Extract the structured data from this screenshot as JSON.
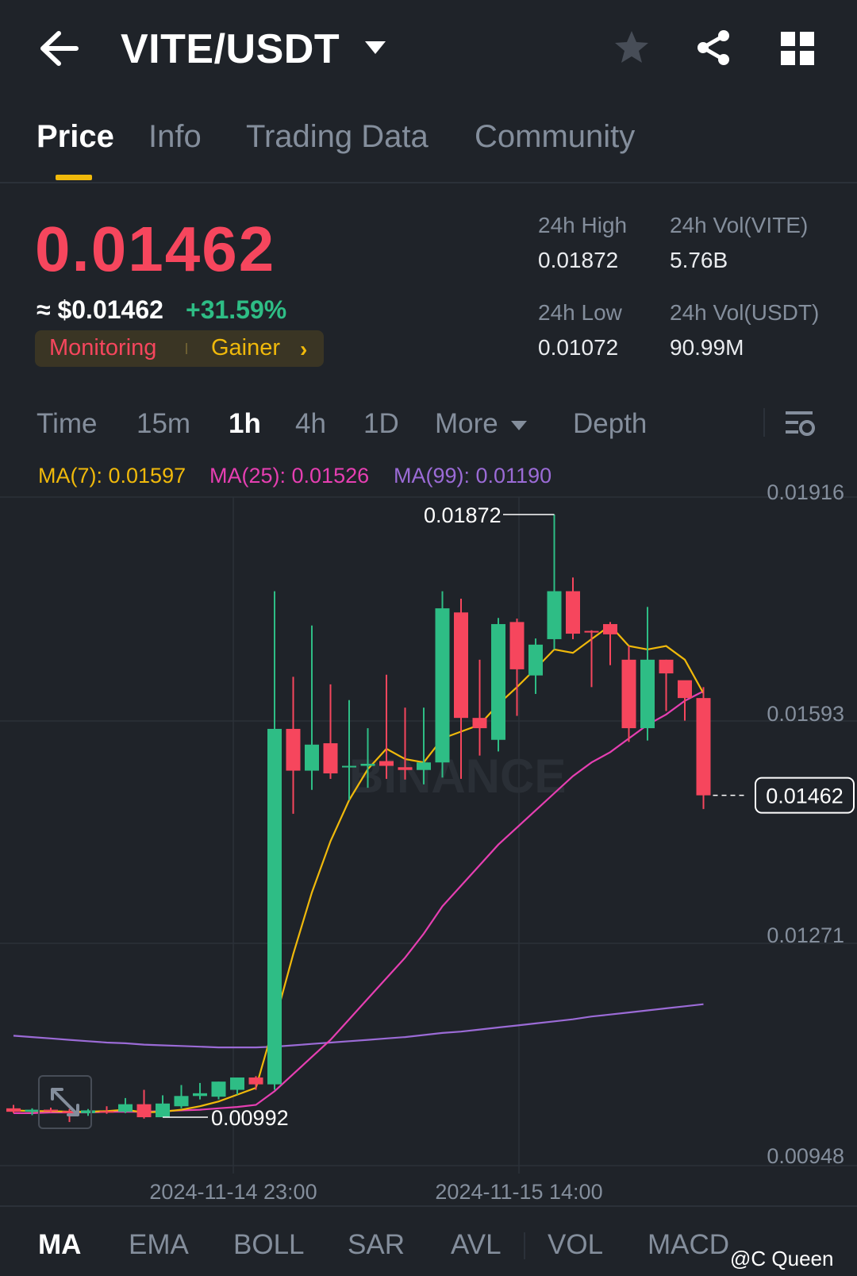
{
  "header": {
    "title": "VITE/USDT",
    "back_icon": "arrow-left-icon",
    "caret_icon": "caret-down-icon",
    "star_icon": "star-icon",
    "share_icon": "share-icon",
    "grid_icon": "grid-icon"
  },
  "tabs": [
    {
      "label": "Price",
      "active": true
    },
    {
      "label": "Info"
    },
    {
      "label": "Trading Data"
    },
    {
      "label": "Community"
    }
  ],
  "price": {
    "last": "0.01462",
    "usd": "≈ $0.01462",
    "change": "+31.59%",
    "tags": {
      "monitoring": "Monitoring",
      "gainer": "Gainer",
      "chevron": "›"
    }
  },
  "stats": {
    "high_label": "24h High",
    "high": "0.01872",
    "low_label": "24h Low",
    "low": "0.01072",
    "vol_base_label": "24h Vol(VITE)",
    "vol_base": "5.76B",
    "vol_quote_label": "24h Vol(USDT)",
    "vol_quote": "90.99M"
  },
  "intervals": {
    "time": "Time",
    "m15": "15m",
    "h1": "1h",
    "h4": "4h",
    "d1": "1D",
    "more": "More",
    "depth": "Depth",
    "active": "1h"
  },
  "ma_legend": {
    "ma7": "MA(7): 0.01597",
    "ma25": "MA(25): 0.01526",
    "ma99": "MA(99): 0.01190"
  },
  "indicators": [
    "MA",
    "EMA",
    "BOLL",
    "SAR",
    "AVL",
    "VOL",
    "MACD"
  ],
  "watermark": "@C Queen",
  "colors": {
    "up": "#2ebd85",
    "down": "#f6465d",
    "ma7": "#f0b90b",
    "ma25": "#e63fb2",
    "ma99": "#9b6bd6",
    "accent": "#f0b90b"
  },
  "chart_data": {
    "type": "candlestick",
    "y_ticks": [
      "0.01916",
      "0.01593",
      "0.01271",
      "0.00948"
    ],
    "ylim": [
      0.00948,
      0.01916
    ],
    "x_ticks": [
      "2024-11-14 23:00",
      "2024-11-15 14:00"
    ],
    "last_price_label": "0.01462",
    "high_marker": "0.01872",
    "low_marker": "0.00992",
    "watermark": "BINANCE",
    "candles": [
      {
        "o": 0.01005,
        "h": 0.0101,
        "l": 0.00998,
        "c": 0.01
      },
      {
        "o": 0.01,
        "h": 0.01005,
        "l": 0.00995,
        "c": 0.01003
      },
      {
        "o": 0.01003,
        "h": 0.01006,
        "l": 0.00999,
        "c": 0.01001
      },
      {
        "o": 0.01001,
        "h": 0.01004,
        "l": 0.00985,
        "c": 0.00998
      },
      {
        "o": 0.00998,
        "h": 0.01004,
        "l": 0.00994,
        "c": 0.01002
      },
      {
        "o": 0.01001,
        "h": 0.01008,
        "l": 0.00997,
        "c": 0.00999
      },
      {
        "o": 0.01,
        "h": 0.0102,
        "l": 0.00998,
        "c": 0.01011
      },
      {
        "o": 0.01011,
        "h": 0.01032,
        "l": 0.0099,
        "c": 0.00992
      },
      {
        "o": 0.00992,
        "h": 0.01024,
        "l": 0.00992,
        "c": 0.01012
      },
      {
        "o": 0.01008,
        "h": 0.01039,
        "l": 0.01005,
        "c": 0.01023
      },
      {
        "o": 0.01023,
        "h": 0.01042,
        "l": 0.01018,
        "c": 0.01027
      },
      {
        "o": 0.01022,
        "h": 0.01044,
        "l": 0.01018,
        "c": 0.01044
      },
      {
        "o": 0.01032,
        "h": 0.0105,
        "l": 0.01025,
        "c": 0.0105
      },
      {
        "o": 0.0105,
        "h": 0.01052,
        "l": 0.01032,
        "c": 0.0104
      },
      {
        "o": 0.0104,
        "h": 0.0176,
        "l": 0.01032,
        "c": 0.01559
      },
      {
        "o": 0.01559,
        "h": 0.01635,
        "l": 0.01435,
        "c": 0.01498
      },
      {
        "o": 0.01498,
        "h": 0.0171,
        "l": 0.0147,
        "c": 0.01536
      },
      {
        "o": 0.01538,
        "h": 0.01624,
        "l": 0.01486,
        "c": 0.01494
      },
      {
        "o": 0.01505,
        "h": 0.01601,
        "l": 0.01455,
        "c": 0.01505
      },
      {
        "o": 0.01505,
        "h": 0.0156,
        "l": 0.01473,
        "c": 0.01508
      },
      {
        "o": 0.01512,
        "h": 0.01638,
        "l": 0.01486,
        "c": 0.01505
      },
      {
        "o": 0.01503,
        "h": 0.0159,
        "l": 0.01485,
        "c": 0.01499
      },
      {
        "o": 0.01499,
        "h": 0.0159,
        "l": 0.01478,
        "c": 0.0151
      },
      {
        "o": 0.0151,
        "h": 0.0176,
        "l": 0.01488,
        "c": 0.01735
      },
      {
        "o": 0.01729,
        "h": 0.01749,
        "l": 0.01486,
        "c": 0.01575
      },
      {
        "o": 0.01575,
        "h": 0.0166,
        "l": 0.0152,
        "c": 0.0156
      },
      {
        "o": 0.01543,
        "h": 0.01721,
        "l": 0.01526,
        "c": 0.01712
      },
      {
        "o": 0.01715,
        "h": 0.0172,
        "l": 0.01578,
        "c": 0.01646
      },
      {
        "o": 0.01637,
        "h": 0.01691,
        "l": 0.0161,
        "c": 0.01682
      },
      {
        "o": 0.0169,
        "h": 0.01872,
        "l": 0.01675,
        "c": 0.0176
      },
      {
        "o": 0.0176,
        "h": 0.0178,
        "l": 0.0169,
        "c": 0.01698
      },
      {
        "o": 0.01702,
        "h": 0.01703,
        "l": 0.0162,
        "c": 0.017
      },
      {
        "o": 0.01712,
        "h": 0.01715,
        "l": 0.01652,
        "c": 0.01697
      },
      {
        "o": 0.0166,
        "h": 0.0168,
        "l": 0.0154,
        "c": 0.0156
      },
      {
        "o": 0.0156,
        "h": 0.01737,
        "l": 0.01542,
        "c": 0.0166
      },
      {
        "o": 0.0166,
        "h": 0.0166,
        "l": 0.01585,
        "c": 0.0164
      },
      {
        "o": 0.0163,
        "h": 0.0162,
        "l": 0.01571,
        "c": 0.01604
      },
      {
        "o": 0.01604,
        "h": 0.0162,
        "l": 0.01442,
        "c": 0.01462
      }
    ],
    "ma7": [
      0.01002,
      0.01001,
      0.01001,
      0.01,
      0.01,
      0.01001,
      0.01003,
      0.00999,
      0.01,
      0.01003,
      0.01008,
      0.01015,
      0.01025,
      0.01035,
      0.0113,
      0.0123,
      0.0132,
      0.01395,
      0.01455,
      0.015,
      0.0153,
      0.01515,
      0.0151,
      0.01545,
      0.01555,
      0.01565,
      0.01595,
      0.0162,
      0.01647,
      0.01675,
      0.0167,
      0.0169,
      0.0171,
      0.0168,
      0.01675,
      0.0168,
      0.0166,
      0.01611
    ],
    "ma25": [
      0.00998,
      0.00998,
      0.00999,
      0.00999,
      0.00999,
      0.01,
      0.01,
      0.01,
      0.01001,
      0.01002,
      0.01003,
      0.01005,
      0.01007,
      0.0101,
      0.0103,
      0.01055,
      0.0108,
      0.01105,
      0.01135,
      0.01165,
      0.01195,
      0.01225,
      0.0126,
      0.013,
      0.0133,
      0.0136,
      0.0139,
      0.01415,
      0.0144,
      0.01465,
      0.0149,
      0.0151,
      0.01525,
      0.01545,
      0.01565,
      0.0158,
      0.016,
      0.01614
    ],
    "ma99": [
      0.01111,
      0.01109,
      0.01107,
      0.01105,
      0.01103,
      0.01101,
      0.011,
      0.01098,
      0.01097,
      0.01096,
      0.01095,
      0.01094,
      0.01094,
      0.01094,
      0.01095,
      0.01097,
      0.01099,
      0.01101,
      0.01103,
      0.01105,
      0.01107,
      0.01109,
      0.01112,
      0.01115,
      0.01117,
      0.0112,
      0.01123,
      0.01126,
      0.01129,
      0.01132,
      0.01135,
      0.01139,
      0.01142,
      0.01145,
      0.01148,
      0.01151,
      0.01154,
      0.01157
    ]
  }
}
